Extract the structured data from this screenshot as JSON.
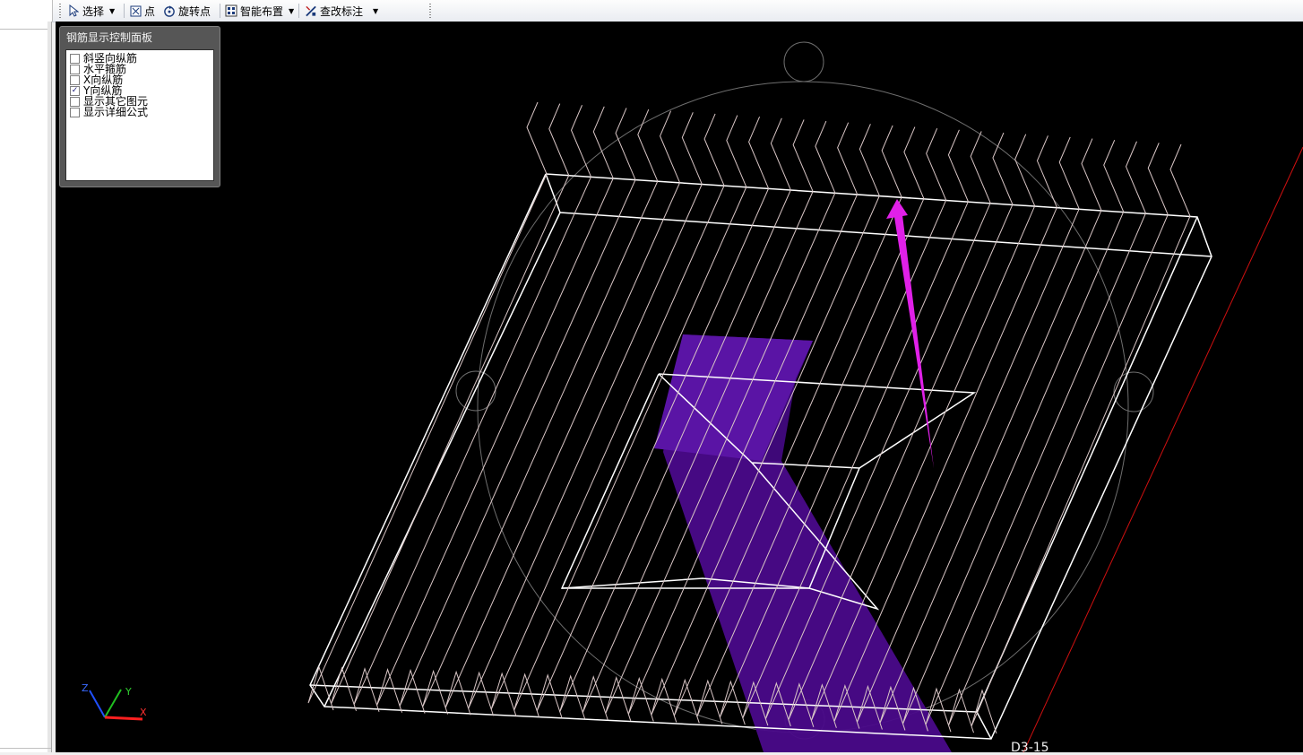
{
  "toolbar": {
    "items": [
      {
        "label": "选择",
        "icon": "cursor-arrow-icon",
        "dropdown": true
      },
      {
        "label": "点",
        "icon": "point-icon"
      },
      {
        "label": "旋转点",
        "icon": "rotate-point-icon"
      },
      {
        "label": "智能布置",
        "icon": "smart-layout-icon",
        "dropdown": true
      },
      {
        "label": "查改标注",
        "icon": "edit-annotation-icon",
        "dropdown": true
      }
    ]
  },
  "rebar_panel": {
    "title": "钢筋显示控制面板",
    "options": [
      {
        "label": "斜竖向纵筋",
        "checked": false
      },
      {
        "label": "水平箍筋",
        "checked": false
      },
      {
        "label": "X向纵筋",
        "checked": false
      },
      {
        "label": "Y向纵筋",
        "checked": true
      },
      {
        "label": "显示其它图元",
        "checked": false
      },
      {
        "label": "显示详细公式",
        "checked": false
      }
    ]
  },
  "axis_gizmo": {
    "x_label": "X",
    "y_label": "Y",
    "z_label": "Z"
  },
  "viewport": {
    "bottom_label": "D3-15"
  },
  "colors": {
    "background": "#000000",
    "slab_outline": "#ffffff",
    "rebar": "#d9c6c6",
    "column": "#5a0aa0",
    "arrow": "#e020e8",
    "orbit_circle": "#6e6e6e",
    "red_axis": "#d01010"
  }
}
